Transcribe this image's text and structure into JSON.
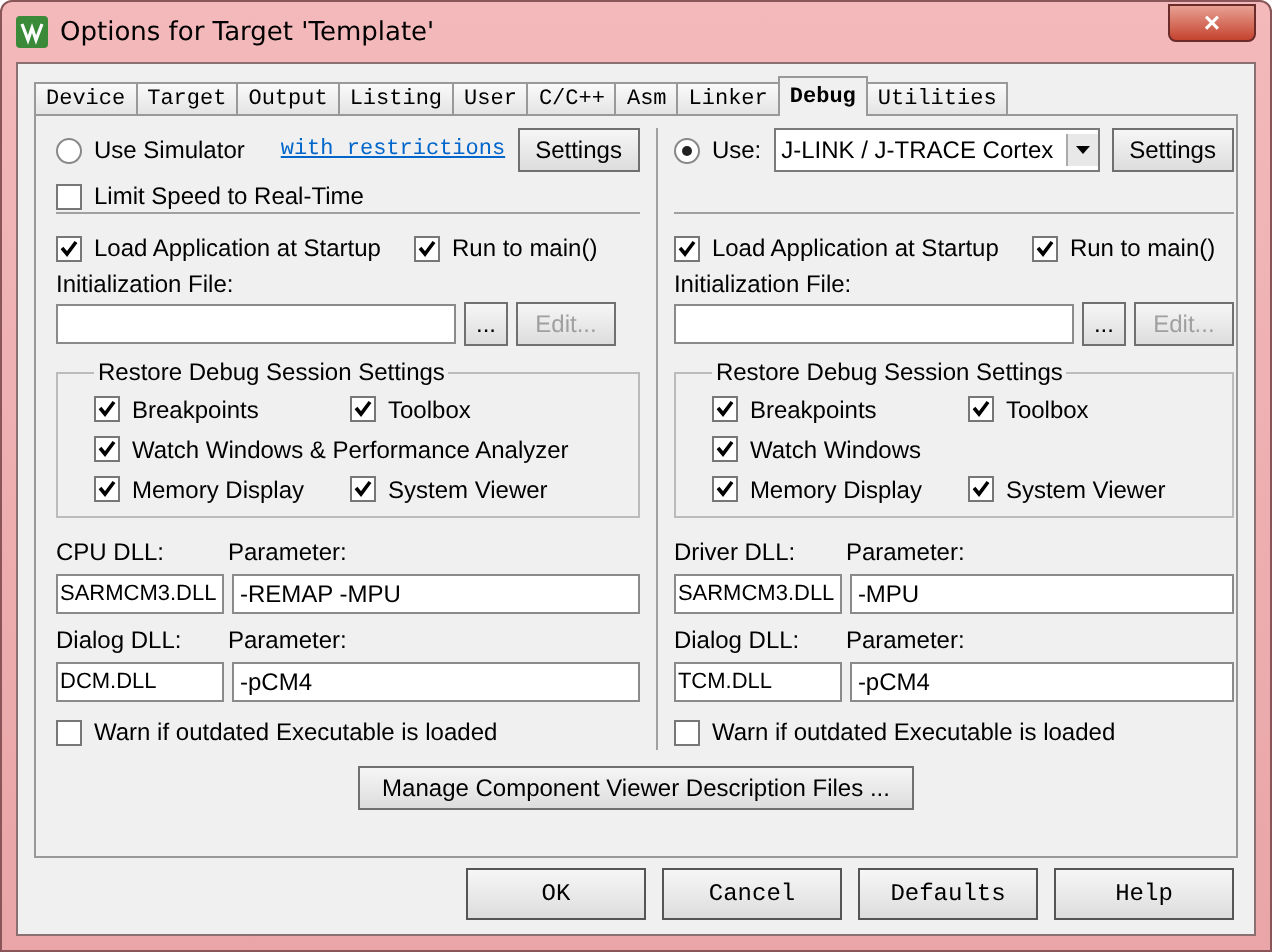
{
  "window": {
    "title": "Options for Target 'Template'",
    "close": "×"
  },
  "tabs": [
    {
      "label": "Device",
      "selected": false
    },
    {
      "label": "Target",
      "selected": false
    },
    {
      "label": "Output",
      "selected": false
    },
    {
      "label": "Listing",
      "selected": false
    },
    {
      "label": "User",
      "selected": false
    },
    {
      "label": "C/C++",
      "selected": false
    },
    {
      "label": "Asm",
      "selected": false
    },
    {
      "label": "Linker",
      "selected": false
    },
    {
      "label": "Debug",
      "selected": true
    },
    {
      "label": "Utilities",
      "selected": false
    }
  ],
  "panes": [
    {
      "source": {
        "kind": "simulator",
        "label": "Use Simulator",
        "selected": false,
        "link": "with restrictions",
        "settings": "Settings"
      },
      "limit_speed": {
        "label": "Limit Speed to Real-Time",
        "checked": false
      },
      "load_app": {
        "label": "Load Application at Startup",
        "checked": true
      },
      "run_to_main": {
        "label": "Run to main()",
        "checked": true
      },
      "init_file": {
        "label": "Initialization File:",
        "browse": "...",
        "edit": "Edit...",
        "edit_disabled": true
      },
      "restore": {
        "title": "Restore Debug Session Settings",
        "rows": [
          {
            "items": [
              {
                "label": "Breakpoints",
                "checked": true
              },
              {
                "label": "Toolbox",
                "checked": true
              }
            ]
          },
          {
            "items": [
              {
                "label": "Watch Windows & Performance Analyzer",
                "checked": true
              }
            ]
          },
          {
            "items": [
              {
                "label": "Memory Display",
                "checked": true
              },
              {
                "label": "System Viewer",
                "checked": true
              }
            ]
          }
        ]
      },
      "dlls": [
        {
          "label": "CPU DLL:",
          "value": "SARMCM3.DLL",
          "param_label": "Parameter:",
          "param": "-REMAP -MPU"
        },
        {
          "label": "Dialog DLL:",
          "value": "DCM.DLL",
          "param_label": "Parameter:",
          "param": "-pCM4"
        }
      ],
      "warn": {
        "label": "Warn if outdated Executable is loaded",
        "checked": false
      }
    },
    {
      "source": {
        "kind": "target",
        "label": "Use:",
        "selected": true,
        "dropdown": "J-LINK / J-TRACE Cortex",
        "settings": "Settings"
      },
      "load_app": {
        "label": "Load Application at Startup",
        "checked": true
      },
      "run_to_main": {
        "label": "Run to main()",
        "checked": true
      },
      "init_file": {
        "label": "Initialization File:",
        "browse": "...",
        "edit": "Edit...",
        "edit_disabled": true
      },
      "restore": {
        "title": "Restore Debug Session Settings",
        "rows": [
          {
            "items": [
              {
                "label": "Breakpoints",
                "checked": true
              },
              {
                "label": "Toolbox",
                "checked": true
              }
            ]
          },
          {
            "items": [
              {
                "label": "Watch Windows",
                "checked": true
              }
            ]
          },
          {
            "items": [
              {
                "label": "Memory Display",
                "checked": true
              },
              {
                "label": "System Viewer",
                "checked": true
              }
            ]
          }
        ]
      },
      "dlls": [
        {
          "label": "Driver DLL:",
          "value": "SARMCM3.DLL",
          "param_label": "Parameter:",
          "param": "-MPU"
        },
        {
          "label": "Dialog DLL:",
          "value": "TCM.DLL",
          "param_label": "Parameter:",
          "param": "-pCM4"
        }
      ],
      "warn": {
        "label": "Warn if outdated Executable is loaded",
        "checked": false
      }
    }
  ],
  "manage_button": "Manage Component Viewer Description Files ...",
  "buttons": [
    "OK",
    "Cancel",
    "Defaults",
    "Help"
  ]
}
